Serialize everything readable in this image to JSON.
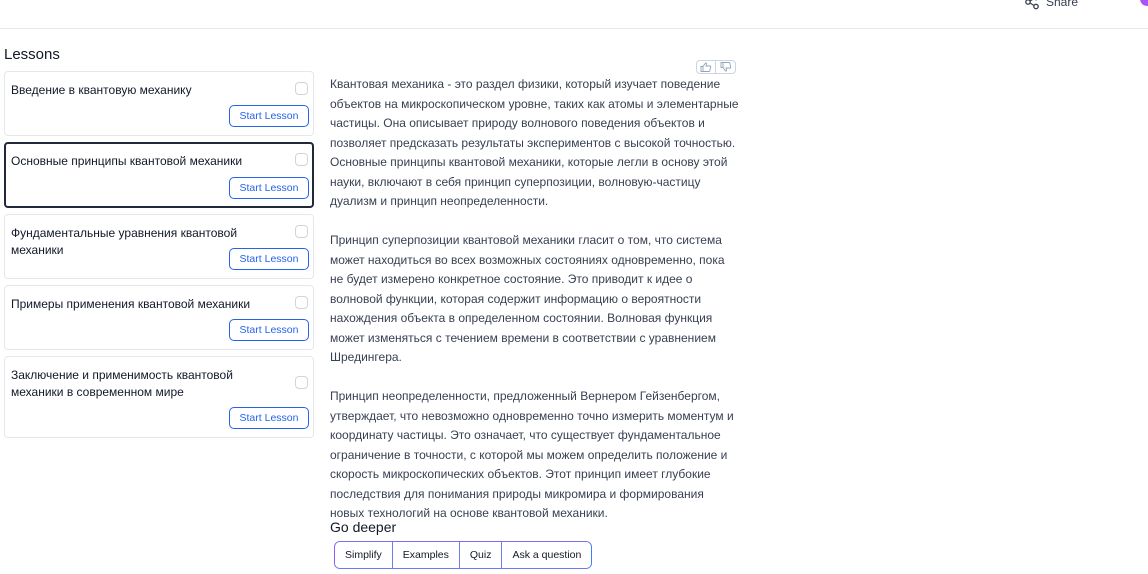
{
  "header": {
    "share_label": "Share",
    "share_icon": "share-icon"
  },
  "sidebar": {
    "title": "Lessons",
    "start_label": "Start Lesson",
    "lessons": [
      {
        "title": "Введение в квантовую механику",
        "active": false,
        "completed": false
      },
      {
        "title": "Основные принципы квантовой механики",
        "active": true,
        "completed": false
      },
      {
        "title": "Фундаментальные уравнения квантовой механики",
        "active": false,
        "completed": false
      },
      {
        "title": "Примеры применения квантовой механики",
        "active": false,
        "completed": false
      },
      {
        "title": "Заключение и применимость квантовой механики в современном мире",
        "active": false,
        "completed": false
      }
    ]
  },
  "feedback": {
    "up_icon": "thumbs-up-icon",
    "down_icon": "thumbs-down-icon"
  },
  "content": {
    "paragraphs": [
      "Квантовая механика - это раздел физики, который изучает поведение объектов на микроскопическом уровне, таких как атомы и элементарные частицы. Она описывает природу волнового поведения объектов и позволяет предсказать результаты экспериментов с высокой точностью. Основные принципы квантовой механики, которые легли в основу этой науки, включают в себя принцип суперпозиции, волновую-частицу дуализм и принцип неопределенности.",
      "Принцип суперпозиции квантовой механики гласит о том, что система может находиться во всех возможных состояниях одновременно, пока не будет измерено конкретное состояние. Это приводит к идее о волновой функции, которая содержит информацию о вероятности нахождения объекта в определенном состоянии. Волновая функция может изменяться с течением времени в соответствии с уравнением Шредингера.",
      "Принцип неопределенности, предложенный Вернером Гейзенбергом, утверждает, что невозможно одновременно точно измерить моментум и координату частицы. Это означает, что существует фундаментальное ограничение в точности, с которой мы можем определить положение и скорость микроскопических объектов. Этот принцип имеет глубокие последствия для понимания природы микромира и формирования новых технологий на основе квантовой механики."
    ]
  },
  "go_deeper": {
    "title": "Go deeper",
    "buttons": [
      "Simplify",
      "Examples",
      "Quiz",
      "Ask a question"
    ]
  },
  "colors": {
    "accent": "#2563eb",
    "gradient_start": "#8b5cf6",
    "gradient_end": "#3b82f6"
  }
}
